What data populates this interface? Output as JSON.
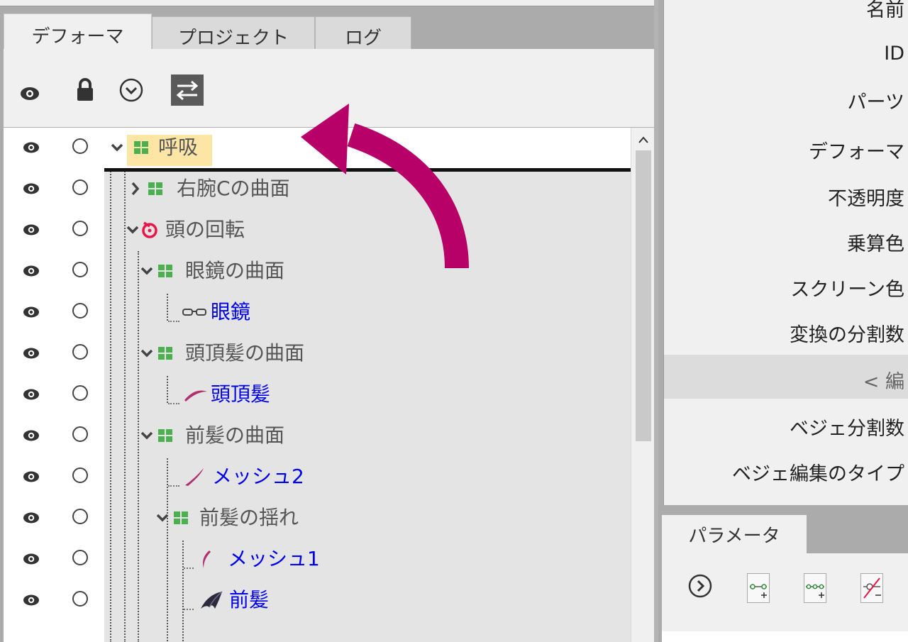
{
  "left_panel": {
    "tabs": [
      {
        "label": "デフォーマ",
        "active": true
      },
      {
        "label": "プロジェクト",
        "active": false
      },
      {
        "label": "ログ",
        "active": false
      }
    ],
    "toolbar_icons": [
      "eye-icon",
      "lock-icon",
      "chevron-circle-down-icon",
      "swap-arrows-icon"
    ],
    "tree": [
      {
        "label": "呼吸",
        "type": "warp",
        "style": "gray",
        "highlight": true
      },
      {
        "label": "右腕Cの曲面",
        "type": "warp",
        "style": "gray"
      },
      {
        "label": "頭の回転",
        "type": "rotation",
        "style": "gray"
      },
      {
        "label": "眼鏡の曲面",
        "type": "warp",
        "style": "gray"
      },
      {
        "label": "眼鏡",
        "type": "art-mesh-glasses",
        "style": "blue"
      },
      {
        "label": "頭頂髪の曲面",
        "type": "warp",
        "style": "gray"
      },
      {
        "label": "頭頂髪",
        "type": "art-mesh-hair",
        "style": "blue"
      },
      {
        "label": "前髪の曲面",
        "type": "warp",
        "style": "gray"
      },
      {
        "label": "メッシュ2",
        "type": "art-mesh-stroke",
        "style": "blue"
      },
      {
        "label": "前髪の揺れ",
        "type": "warp",
        "style": "gray"
      },
      {
        "label": "メッシュ1",
        "type": "art-mesh-stroke",
        "style": "blue"
      },
      {
        "label": "前髪",
        "type": "art-mesh-bangs",
        "style": "blue"
      }
    ]
  },
  "right_panel": {
    "properties": [
      "名前",
      "ID",
      "パーツ",
      "デフォーマ",
      "不透明度",
      "乗算色",
      "スクリーン色",
      "変換の分割数"
    ],
    "section_header": "< 編",
    "properties_extra": [
      "ベジェ分割数",
      "ベジェ編集のタイプ"
    ],
    "params_tab": "パラメータ",
    "params_toolbar_icons": [
      "chevron-circle-right-icon",
      "add-key-icon",
      "add-keys-icon",
      "remove-key-icon"
    ]
  },
  "colors": {
    "warp_icon": "#4caf50",
    "rotation_icon": "#e8174a",
    "mesh_icon": "#b0306e",
    "arrow": "#b80069",
    "highlight": "#fde5a6",
    "blue_label": "#0000ee"
  }
}
